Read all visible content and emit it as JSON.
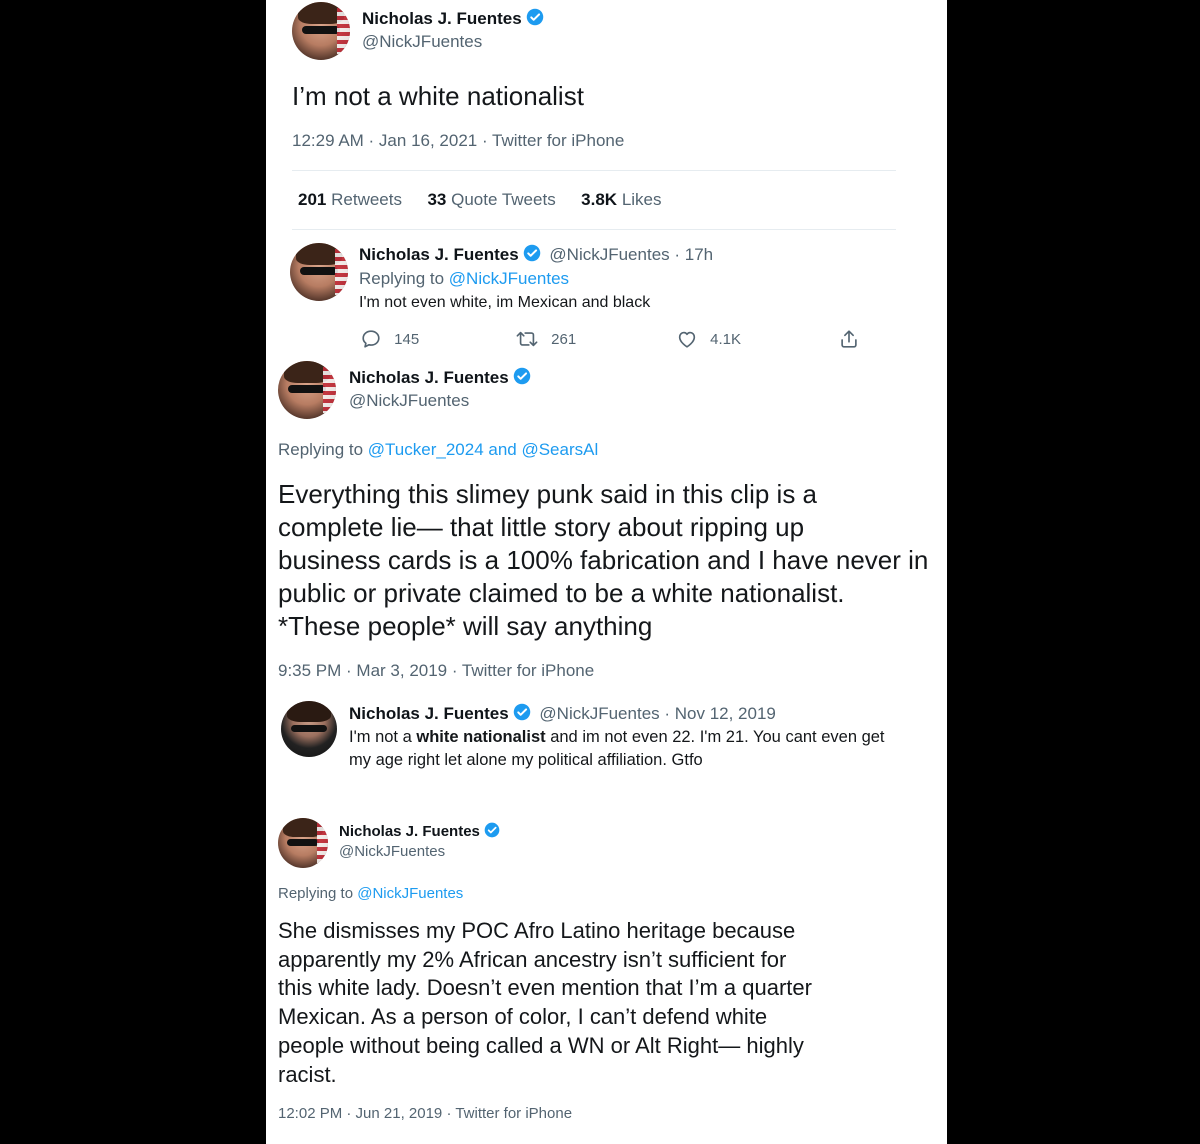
{
  "colors": {
    "link": "#1d9bf0",
    "muted": "#536471",
    "verified": "#1d9bf0"
  },
  "tweet1": {
    "name": "Nicholas J. Fuentes",
    "handle": "@NickJFuentes",
    "text": "I’m not a white nationalist",
    "meta": "12:29 AM · Jan 16, 2021 · Twitter for iPhone",
    "stats": {
      "retweets_count": "201",
      "retweets_label": "Retweets",
      "quotes_count": "33",
      "quotes_label": "Quote Tweets",
      "likes_count": "3.8K",
      "likes_label": "Likes"
    }
  },
  "reply1": {
    "name": "Nicholas J. Fuentes",
    "handle_time": "@NickJFuentes · 17h",
    "replying_prefix": "Replying to",
    "replying_to": "@NickJFuentes",
    "text": "I'm not even white, im Mexican and black",
    "actions": {
      "replies": "145",
      "retweets": "261",
      "likes": "4.1K"
    },
    "icons": [
      "reply-icon",
      "retweet-icon",
      "like-icon",
      "share-icon"
    ]
  },
  "tweet2": {
    "name": "Nicholas J. Fuentes",
    "handle": "@NickJFuentes",
    "replying_prefix": "Replying to",
    "replying_to": "@Tucker_2024 and @SearsAl",
    "lines": [
      "Everything this slimey punk said in this clip is a",
      "complete lie— that little story about ripping up",
      "business cards is a 100% fabrication and I have never in",
      "public or private claimed to be a white nationalist.",
      "*These people* will say anything"
    ],
    "meta": "9:35 PM · Mar 3, 2019 · Twitter for iPhone"
  },
  "quote2": {
    "name": "Nicholas J. Fuentes",
    "handle_date": "@NickJFuentes · Nov 12, 2019",
    "line1_pre": "I'm not a ",
    "line1_bold": "white nationalist",
    "line1_post": " and im not even 22. I'm 21. You cant even get",
    "line2": "my age right let alone my political affiliation. Gtfo"
  },
  "tweet3": {
    "name": "Nicholas J. Fuentes",
    "handle": "@NickJFuentes",
    "replying_prefix": "Replying to",
    "replying_to": "@NickJFuentes",
    "lines": [
      "She dismisses my POC Afro Latino heritage because",
      "apparently my 2% African ancestry isn’t sufficient for",
      "this white lady. Doesn’t even mention that I’m a quarter",
      "Mexican. As a person of color, I can’t defend white",
      "people without being called a WN or Alt Right— highly",
      "racist."
    ],
    "meta": "12:02 PM · Jun 21, 2019 · Twitter for iPhone"
  }
}
